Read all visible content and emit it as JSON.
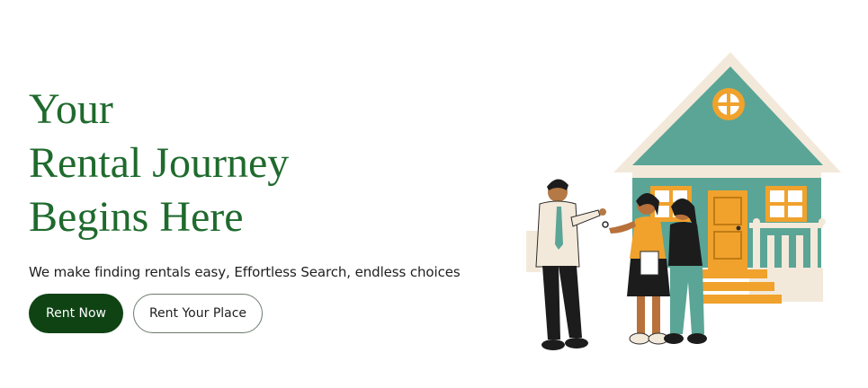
{
  "hero": {
    "headline_lines": [
      "Your",
      "Rental Journey",
      "Begins Here"
    ],
    "tagline": "We make finding rentals easy, Effortless Search, endless choices"
  },
  "actions": {
    "primary_label": "Rent Now",
    "secondary_label": "Rent Your Place"
  },
  "colors": {
    "headline": "#1f6a2d",
    "primary_button": "#0f4314",
    "house_teal": "#5aa596",
    "accent_orange": "#f0a22c",
    "cream": "#f3e9da"
  },
  "illustration": {
    "description_icon": "house-with-people-illustration"
  }
}
